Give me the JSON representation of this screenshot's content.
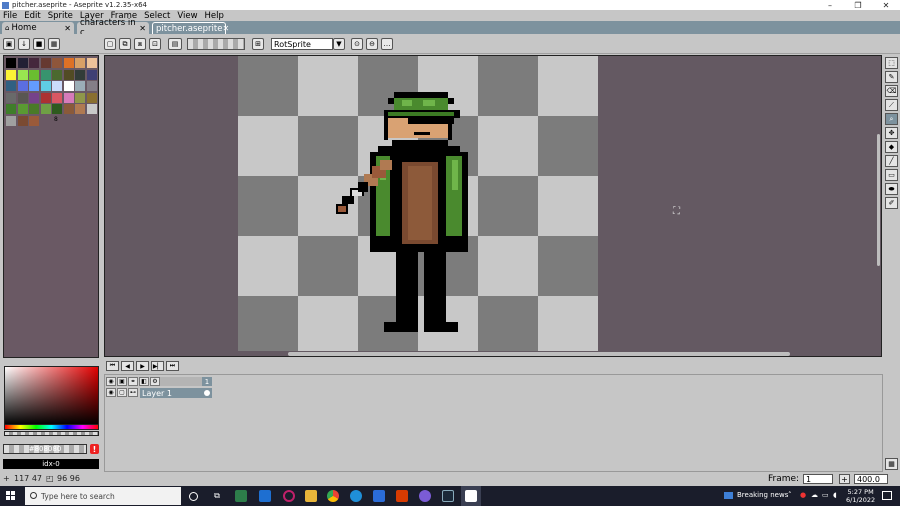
{
  "window": {
    "title": "pitcher.aseprite - Aseprite v1.2.35-x64",
    "minimize": "–",
    "maximize": "❐",
    "close": "✕"
  },
  "menu": [
    "File",
    "Edit",
    "Sprite",
    "Layer",
    "Frame",
    "Select",
    "View",
    "Help"
  ],
  "tabs": [
    {
      "label": "Home",
      "icon": "home-icon"
    },
    {
      "label": "characters in c",
      "icon": "document-icon"
    },
    {
      "label": "pitcher.aseprite",
      "active": true
    }
  ],
  "toolbar": {
    "rotation_algorithm": "RotSprite",
    "button_labels": [
      "ink",
      "lock",
      "save",
      "grid"
    ]
  },
  "palette": {
    "colors": [
      "#000000",
      "#222034",
      "#45283c",
      "#663931",
      "#8f563b",
      "#df7126",
      "#d9a066",
      "#eec39a",
      "#fbf236",
      "#99e550",
      "#6abe30",
      "#37946e",
      "#4b692f",
      "#524b24",
      "#323c39",
      "#3f3f74",
      "#306082",
      "#5b6ee1",
      "#639bff",
      "#5fcde4",
      "#cbdbfc",
      "#ffffff",
      "#9badb7",
      "#847e87",
      "#696a6a",
      "#595652",
      "#76428a",
      "#ac3232",
      "#d95763",
      "#d77bba",
      "#8f974a",
      "#8a6f30",
      "#3f7d2a",
      "#5a9a32",
      "#4a7a28",
      "#6fa045",
      "#2e5a1e",
      "#8a5a3a",
      "#b07a52",
      "#c9c9c9",
      "#a0a0a0",
      "#7a4a32",
      "#9a5a3a"
    ],
    "count_label": "8"
  },
  "canvas": {
    "checker_light": "#c8c8c8",
    "checker_dark": "#7c7c7c",
    "background": "#645962"
  },
  "tools": [
    "marquee-icon",
    "pencil-icon",
    "eraser-icon",
    "eyedropper-icon",
    "zoom-icon",
    "move-icon",
    "fill-icon",
    "line-icon",
    "rectangle-icon",
    "blob-icon",
    "contour-icon"
  ],
  "color": {
    "hex_placeholder": "#808080",
    "index": "idx-0",
    "warning": "!"
  },
  "timeline": {
    "layer_name": "Layer 1",
    "frame_number": "1"
  },
  "status": {
    "cursor_pos": "117 47",
    "sprite_size": "96 96",
    "frame_label": "Frame:",
    "frame_value": "1",
    "zoom_value": "400.0",
    "zoom_plus": "+"
  },
  "taskbar": {
    "search_placeholder": "Type here to search",
    "news": "Breaking news",
    "time": "5:27 PM",
    "date": "6/1/2022"
  }
}
